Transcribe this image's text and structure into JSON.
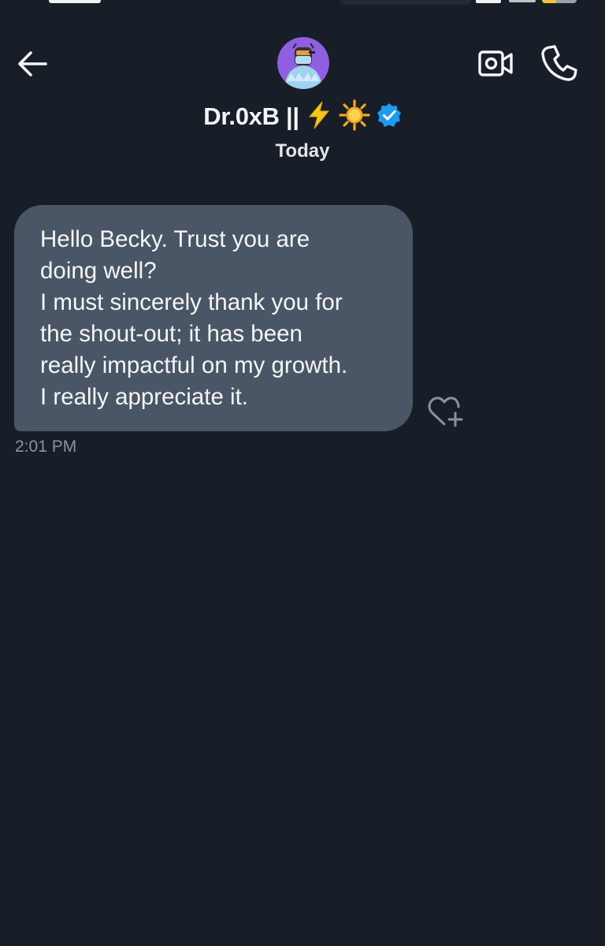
{
  "status_bar": {
    "battery_level": 0.4,
    "battery_color": "#f0c43a"
  },
  "header": {
    "back_icon": "arrow-left-icon",
    "avatar": "avatar",
    "name": "Dr.0xB ||",
    "name_emojis": [
      "lightning-emoji",
      "sun-emoji"
    ],
    "verified_icon": "verified-badge-icon",
    "video_icon": "video-camera-icon",
    "call_icon": "phone-icon"
  },
  "conversation": {
    "date_label": "Today",
    "messages": [
      {
        "lines": [
          "Hello Becky. Trust you are",
          "doing well?",
          "I must sincerely thank you for",
          "the shout-out; it has been",
          "really impactful on my growth.",
          "I really appreciate it."
        ],
        "time": "2:01 PM",
        "reaction_icon": "heart-add-icon"
      }
    ]
  },
  "colors": {
    "background": "#181e28",
    "bubble": "#4a5566",
    "verified": "#1d9bf0",
    "timestamp": "#8c939c"
  }
}
